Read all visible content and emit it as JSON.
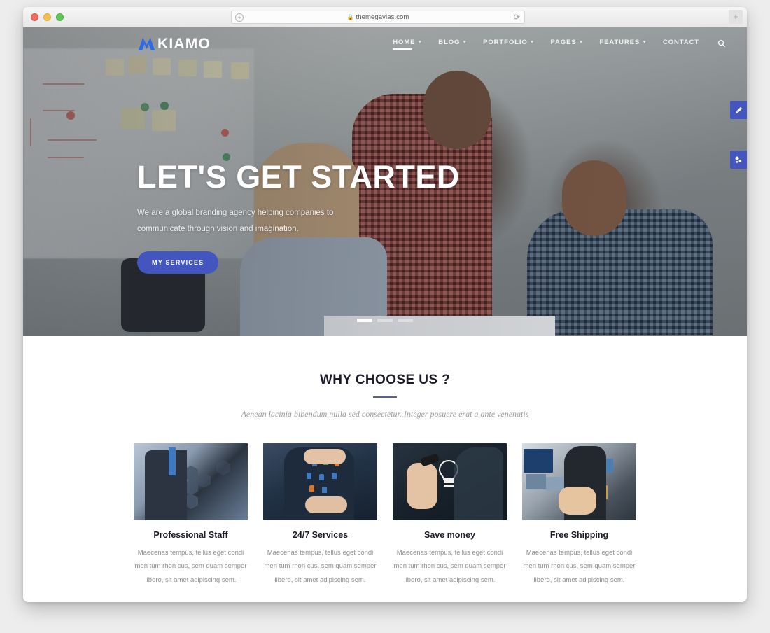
{
  "browser": {
    "url": "themegavias.com",
    "lock_icon": "lock-icon",
    "reload_icon": "reload-icon",
    "back_forward_icon": "add-circle-icon",
    "newtab_label": "+",
    "traffic_lights": [
      "close",
      "minimize",
      "maximize"
    ]
  },
  "site": {
    "logo": {
      "text": "KIAMO",
      "mark_icon": "kiamo-m-logo-icon",
      "mark_color": "#2d6ae3"
    },
    "nav": [
      {
        "label": "HOME",
        "has_caret": true,
        "active": true
      },
      {
        "label": "BLOG",
        "has_caret": true,
        "active": false
      },
      {
        "label": "PORTFOLIO",
        "has_caret": true,
        "active": false
      },
      {
        "label": "PAGES",
        "has_caret": true,
        "active": false
      },
      {
        "label": "FEATURES",
        "has_caret": true,
        "active": false
      },
      {
        "label": "CONTACT",
        "has_caret": false,
        "active": false
      }
    ],
    "search_icon": "search-icon",
    "caret_glyph": "⌄"
  },
  "hero": {
    "title": "LET'S GET STARTED",
    "subtitle": "We are a global branding agency helping companies to communicate through vision and imagination.",
    "button_label": "MY SERVICES",
    "button_color": "#4356c0",
    "slides": [
      {
        "active": true
      },
      {
        "active": false
      },
      {
        "active": false
      }
    ]
  },
  "side_buttons": [
    {
      "name": "theme-customizer",
      "icon": "paintbrush-icon",
      "glyph": "✐"
    },
    {
      "name": "share-options",
      "icon": "share-gears-icon",
      "glyph": "⚙"
    }
  ],
  "why_choose": {
    "title": "WHY CHOOSE US ?",
    "subtitle": "Aenean lacinia bibendum nulla sed consectetur. Integer posuere erat a ante venenatis",
    "accent_color": "#5b5f86",
    "cards": [
      {
        "title": "Professional Staff",
        "text": "Maecenas tempus, tellus eget condi men tum rhon cus, sem quam semper libero, sit amet adipiscing sem.",
        "image_alt": "businessman-touching-hexagon-interface"
      },
      {
        "title": "24/7 Services",
        "text": "Maecenas tempus, tellus eget condi men tum rhon cus, sem quam semper libero, sit amet adipiscing sem.",
        "image_alt": "hands-holding-people-icons"
      },
      {
        "title": "Save money",
        "text": "Maecenas tempus, tellus eget condi men tum rhon cus, sem quam semper libero, sit amet adipiscing sem.",
        "image_alt": "hand-drawing-lightbulb"
      },
      {
        "title": "Free Shipping",
        "text": "Maecenas tempus, tellus eget condi men tum rhon cus, sem quam semper libero, sit amet adipiscing sem.",
        "image_alt": "hand-with-floating-media-screens"
      }
    ]
  }
}
